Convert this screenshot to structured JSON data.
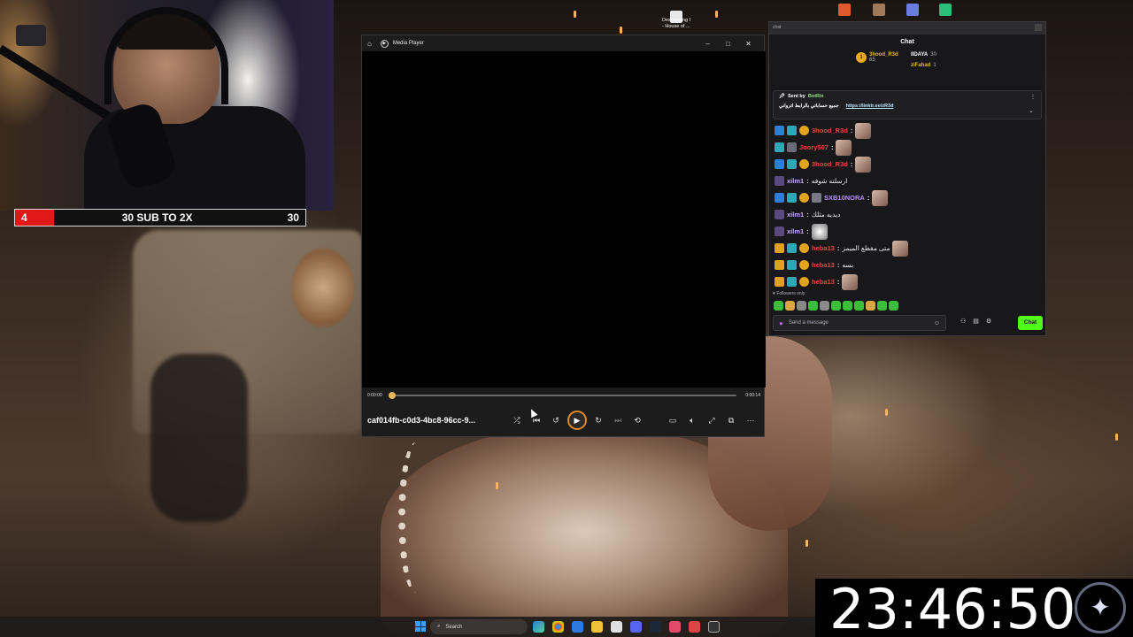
{
  "stream_overlay": {
    "sub_goal": {
      "current": "4",
      "label": "30 SUB TO 2X",
      "target": "30",
      "progress_fraction": 0.133
    },
    "clock": "23:46:50"
  },
  "desktop": {
    "file_label": "Descending I\n- House of ..."
  },
  "media_player": {
    "title": "Media Player",
    "home_icon": "home-icon",
    "time_elapsed": "0:00:00",
    "time_total": "0:00:14",
    "seek_fraction": 0.0,
    "filename": "caf014fb-c0d3-4bc8-96cc-9...",
    "accent_color": "#e08a2c"
  },
  "chat": {
    "title": "Chat",
    "top_bar_label": "chat",
    "leaders": [
      {
        "rank": "1",
        "name": "3hood_R3d",
        "points": "65"
      },
      {
        "rank": "",
        "name": "IIDAYA",
        "points": "30"
      },
      {
        "rank": "",
        "name": "ziFahad",
        "points": "1"
      }
    ],
    "pinned": {
      "sent_by": "Sent by",
      "bot_name": "BotRix",
      "text": "جميع حساباتي بالرابط اترواني",
      "link": "https://linktr.ee/zR3d"
    },
    "messages": [
      {
        "user": "3hood_R3d",
        "color": "#e64545",
        "text": ""
      },
      {
        "user": "Joory507",
        "color": "#e64545",
        "text": ""
      },
      {
        "user": "3hood_R3d",
        "color": "#e64545",
        "text": ""
      },
      {
        "user": "xilm1",
        "color": "#c9a8ff",
        "text": "ارسلته شوفه"
      },
      {
        "user": "SXB10NORA",
        "color": "#b68cff",
        "text": ""
      },
      {
        "user": "xilm1",
        "color": "#c9a8ff",
        "text": "ديديه مثلك"
      },
      {
        "user": "xilm1",
        "color": "#c9a8ff",
        "text": ""
      },
      {
        "user": "heba13",
        "color": "#e64545",
        "text": "متى مقطع الميمز"
      },
      {
        "user": "heba13",
        "color": "#e64545",
        "text": "بسه"
      },
      {
        "user": "heba13",
        "color": "#e64545",
        "text": ""
      }
    ],
    "followers_only": "Followers only",
    "input_placeholder": "Send a message",
    "send_label": "Chat",
    "send_color": "#53fc18"
  },
  "taskbar": {
    "search_label": "Search"
  }
}
